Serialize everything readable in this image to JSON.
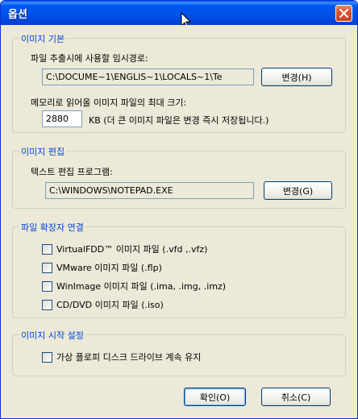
{
  "window": {
    "title": "옵션"
  },
  "image_basic": {
    "legend": "이미지 기본",
    "temp_path_label": "파일 추출시에 사용할 임시경로:",
    "temp_path_value": "C:\\DOCUME~1\\ENGLIS~1\\LOCALS~1\\Te",
    "change_button": "변경(H)",
    "max_size_label": "메모리로 읽어올 이미지 파일의 최대 크기:",
    "max_size_value": "2880",
    "max_size_note": "KB (더 큰 이미지 파일은 변경 즉시 저장됩니다.)"
  },
  "image_edit": {
    "legend": "이미지 편집",
    "editor_label": "텍스트 편집 프로그램:",
    "editor_value": "C:\\WINDOWS\\NOTEPAD.EXE",
    "change_button": "변경(G)"
  },
  "file_assoc": {
    "legend": "파일 확장자 연결",
    "items": [
      {
        "label": "VirtualFDD™ 이미지 파일 (.vfd ,.vfz)",
        "checked": false
      },
      {
        "label": "VMware 이미지 파일 (.flp)",
        "checked": false
      },
      {
        "label": "WinImage 이미지 파일 (.ima, .img, .imz)",
        "checked": false
      },
      {
        "label": "CD/DVD 이미지 파일 (.iso)",
        "checked": false
      }
    ]
  },
  "image_startup": {
    "legend": "이미지 시작 설정",
    "keep_drive_label": "가상 플로피 디스크 드라이브 계속 유지",
    "keep_drive_checked": false
  },
  "footer": {
    "ok_button": "확인(O)",
    "cancel_button": "취소(C)"
  }
}
